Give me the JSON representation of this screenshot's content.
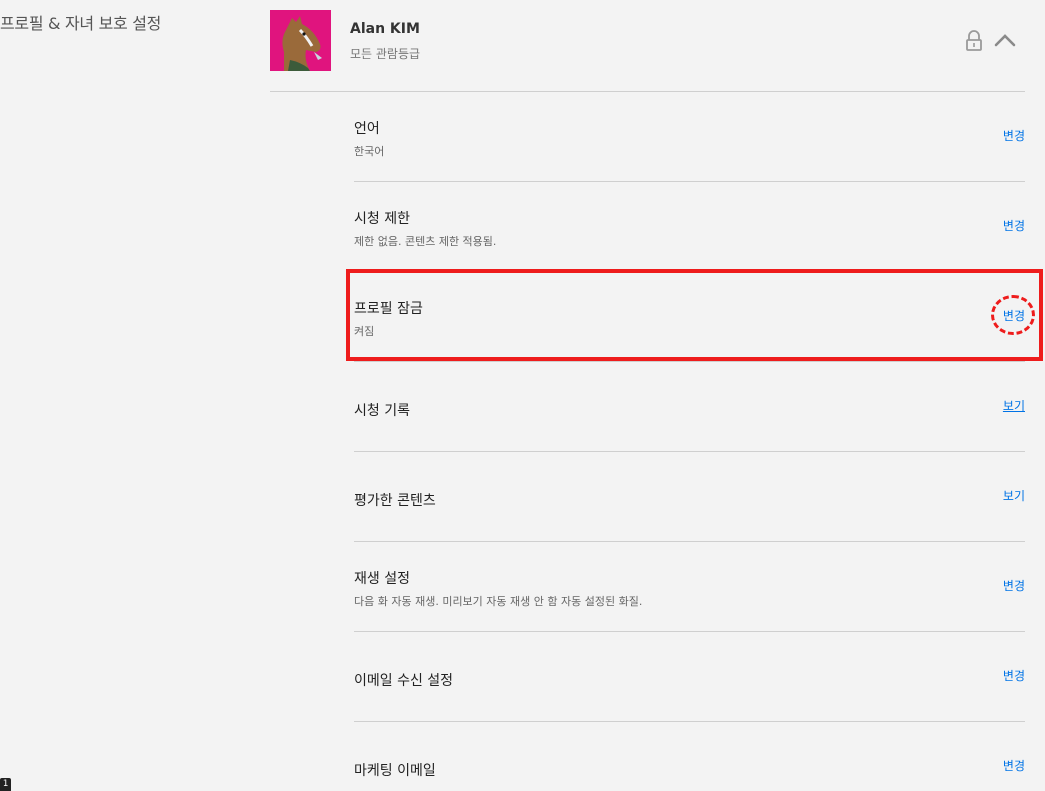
{
  "page": {
    "section_title": "프로필 & 자녀 보호 설정"
  },
  "profile": {
    "name": "Alan KIM",
    "rating": "모든 관람등급",
    "avatar_bg": "#e0147e"
  },
  "settings": [
    {
      "title": "언어",
      "desc": "한국어",
      "action": "변경"
    },
    {
      "title": "시청 제한",
      "desc": "제한 없음. 콘텐츠 제한 적용됨.",
      "action": "변경"
    },
    {
      "title": "프로필 잠금",
      "desc": "켜짐",
      "action": "변경"
    },
    {
      "title": "시청 기록",
      "desc": "",
      "action": "보기"
    },
    {
      "title": "평가한 콘텐츠",
      "desc": "",
      "action": "보기"
    },
    {
      "title": "재생 설정",
      "desc": "다음 화 자동 재생. 미리보기 자동 재생 안 함 자동 설정된 화질.",
      "action": "변경"
    },
    {
      "title": "이메일 수신 설정",
      "desc": "",
      "action": "변경"
    },
    {
      "title": "마케팅 이메일",
      "desc": "",
      "action": "변경"
    }
  ],
  "icons": {
    "lock": "lock-icon",
    "collapse": "chevron-up-icon"
  },
  "colors": {
    "link": "#0073e6",
    "highlight": "#ee1c1c",
    "background": "#f3f3f3"
  },
  "corner_badge": "1"
}
